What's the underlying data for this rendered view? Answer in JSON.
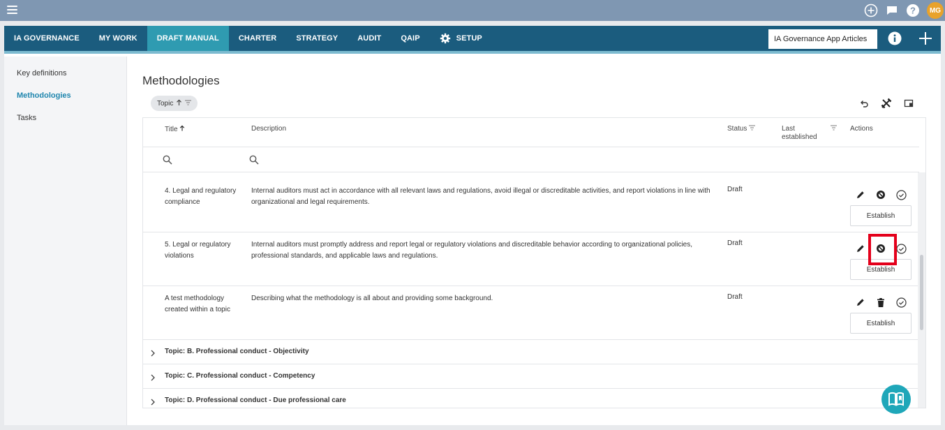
{
  "nav": {
    "tabs": [
      {
        "label": "IA GOVERNANCE"
      },
      {
        "label": "MY WORK"
      },
      {
        "label": "DRAFT MANUAL"
      },
      {
        "label": "CHARTER"
      },
      {
        "label": "STRATEGY"
      },
      {
        "label": "AUDIT"
      },
      {
        "label": "QAIP"
      },
      {
        "label": "SETUP"
      }
    ],
    "search_value": "IA Governance App Articles",
    "active_tab": "DRAFT MANUAL"
  },
  "topbar": {
    "avatar_initials": "MG"
  },
  "sidebar": {
    "items": [
      {
        "label": "Key definitions"
      },
      {
        "label": "Methodologies"
      },
      {
        "label": "Tasks"
      }
    ],
    "active": "Methodologies"
  },
  "page": {
    "title": "Methodologies",
    "chip_label": "Topic"
  },
  "table": {
    "headers": {
      "title": "Title",
      "description": "Description",
      "status": "Status",
      "last_established": "Last established",
      "actions": "Actions"
    },
    "rows": [
      {
        "title": "4. Legal and regulatory compliance",
        "description": "Internal auditors must act in accordance with all relevant laws and regulations, avoid illegal or discreditable activities, and report violations in line with organizational and legal requirements.",
        "status": "Draft",
        "action_label": "Establish"
      },
      {
        "title": "5. Legal or regulatory violations",
        "description": "Internal auditors must promptly address and report legal or regulatory violations and discreditable behavior according to organizational policies, professional standards, and applicable laws and regulations.",
        "status": "Draft",
        "action_label": "Establish"
      },
      {
        "title": "A test methodology created within a topic",
        "description": "Describing what the methodology is all about and providing some background.",
        "status": "Draft",
        "action_label": "Establish"
      }
    ],
    "groups": [
      {
        "label": "Topic: B. Professional conduct - Objectivity"
      },
      {
        "label": "Topic: C. Professional conduct - Competency"
      },
      {
        "label": "Topic: D. Professional conduct - Due professional care"
      }
    ]
  },
  "colors": {
    "navbar": "#1b5c7e",
    "active_tab": "#2f9bb1",
    "accent": "#1f86ae",
    "highlight": "#e4001b",
    "avatar": "#e8a22b"
  }
}
